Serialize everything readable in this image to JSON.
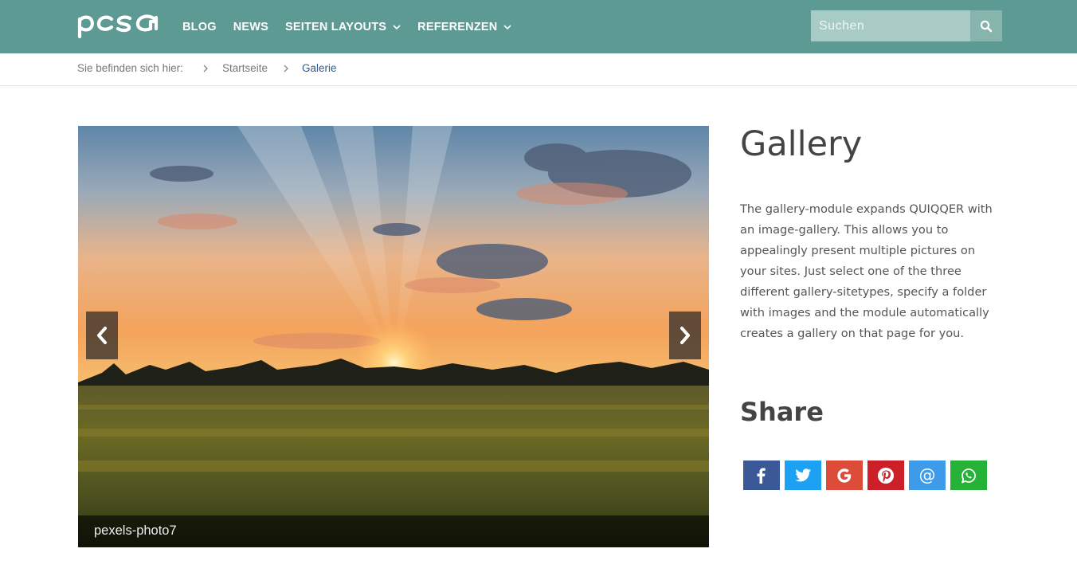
{
  "header": {
    "logo_text": "pcsg",
    "nav": [
      {
        "label": "BLOG",
        "has_dropdown": false
      },
      {
        "label": "NEWS",
        "has_dropdown": false
      },
      {
        "label": "SEITEN LAYOUTS",
        "has_dropdown": true
      },
      {
        "label": "REFERENZEN",
        "has_dropdown": true
      }
    ],
    "search": {
      "placeholder": "Suchen",
      "value": ""
    },
    "colors": {
      "bar": "#5d9a93"
    }
  },
  "breadcrumb": {
    "prefix": "Sie befinden sich hier:",
    "items": [
      "Startseite",
      "Galerie"
    ]
  },
  "gallery": {
    "caption": "pexels-photo7",
    "prev_icon": "chevron-left-icon",
    "next_icon": "chevron-right-icon"
  },
  "main": {
    "title": "Gallery",
    "description": "The gallery-module expands QUIQQER with an image-gallery. This allows you to appealingly present multiple pictures on your sites. Just select one of the three different gallery-sitetypes, specify a folder with images and the module automatically creates a gallery on that page for you."
  },
  "share": {
    "title": "Share",
    "buttons": [
      {
        "name": "facebook",
        "icon": "facebook-icon",
        "color": "#3b5998"
      },
      {
        "name": "twitter",
        "icon": "twitter-icon",
        "color": "#1da1f2"
      },
      {
        "name": "google",
        "icon": "google-icon",
        "color": "#dd4b39"
      },
      {
        "name": "pinterest",
        "icon": "pinterest-icon",
        "color": "#cb2027"
      },
      {
        "name": "email",
        "icon": "at-icon",
        "color": "#3d9be9"
      },
      {
        "name": "whatsapp",
        "icon": "whatsapp-icon",
        "color": "#25b236"
      }
    ]
  }
}
